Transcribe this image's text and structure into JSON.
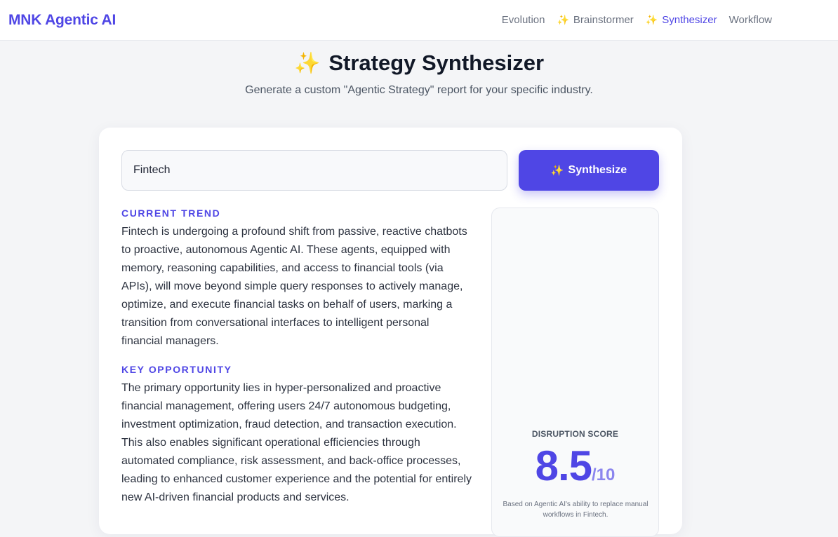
{
  "nav": {
    "brand": "MNK Agentic AI",
    "links": [
      {
        "label": "Evolution",
        "icon": ""
      },
      {
        "label": "Brainstormer",
        "icon": "✨"
      },
      {
        "label": "Synthesizer",
        "icon": "✨"
      },
      {
        "label": "Workflow",
        "icon": ""
      }
    ]
  },
  "hero": {
    "icon": "✨",
    "title": "Strategy Synthesizer",
    "subtitle": "Generate a custom \"Agentic Strategy\" report for your specific industry."
  },
  "form": {
    "industry_value": "Fintech",
    "button_icon": "✨",
    "button_label": "Synthesize"
  },
  "report": {
    "trend_label": "CURRENT TREND",
    "trend_text": "Fintech is undergoing a profound shift from passive, reactive chatbots to proactive, autonomous Agentic AI. These agents, equipped with memory, reasoning capabilities, and access to financial tools (via APIs), will move beyond simple query responses to actively manage, optimize, and execute financial tasks on behalf of users, marking a transition from conversational interfaces to intelligent personal financial managers.",
    "opportunity_label": "KEY OPPORTUNITY",
    "opportunity_text": "The primary opportunity lies in hyper-personalized and proactive financial management, offering users 24/7 autonomous budgeting, investment optimization, fraud detection, and transaction execution. This also enables significant operational efficiencies through automated compliance, risk assessment, and back-office processes, leading to enhanced customer experience and the potential for entirely new AI-driven financial products and services."
  },
  "score": {
    "label": "DISRUPTION SCORE",
    "value": "8.5",
    "max": "/10",
    "note": "Based on Agentic AI's ability to replace manual workflows in Fintech."
  },
  "colors": {
    "accent": "#4f46e5",
    "background": "#f4f5f7",
    "card": "#ffffff"
  }
}
